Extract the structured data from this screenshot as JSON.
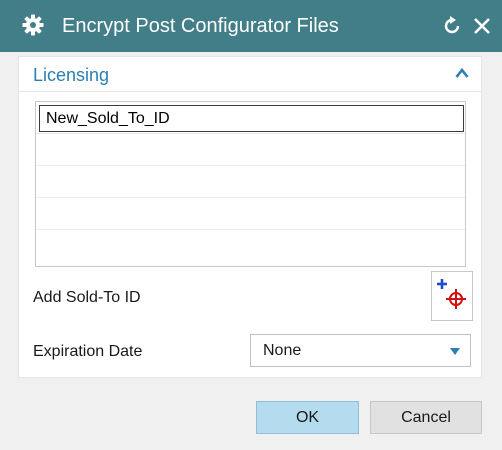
{
  "window": {
    "title": "Encrypt Post Configurator Files"
  },
  "icons": {
    "app": "gear-icon",
    "reset": "reset-icon",
    "close": "close-icon",
    "collapse": "chevron-up-icon",
    "add": "add-point-icon",
    "dropdown": "chevron-down-icon"
  },
  "licensing": {
    "group_title": "Licensing",
    "sold_to_list": [
      "New_Sold_To_ID"
    ],
    "add_sold_to_label": "Add Sold-To ID",
    "expiration_label": "Expiration Date",
    "expiration_value": "None"
  },
  "footer": {
    "ok_label": "OK",
    "cancel_label": "Cancel"
  },
  "colors": {
    "titlebar": "#417e88",
    "group_title": "#2a7fb3",
    "ok_button": "#b5dbef",
    "add_icon_blue": "#1a4fd1",
    "add_icon_red": "#d01010"
  }
}
